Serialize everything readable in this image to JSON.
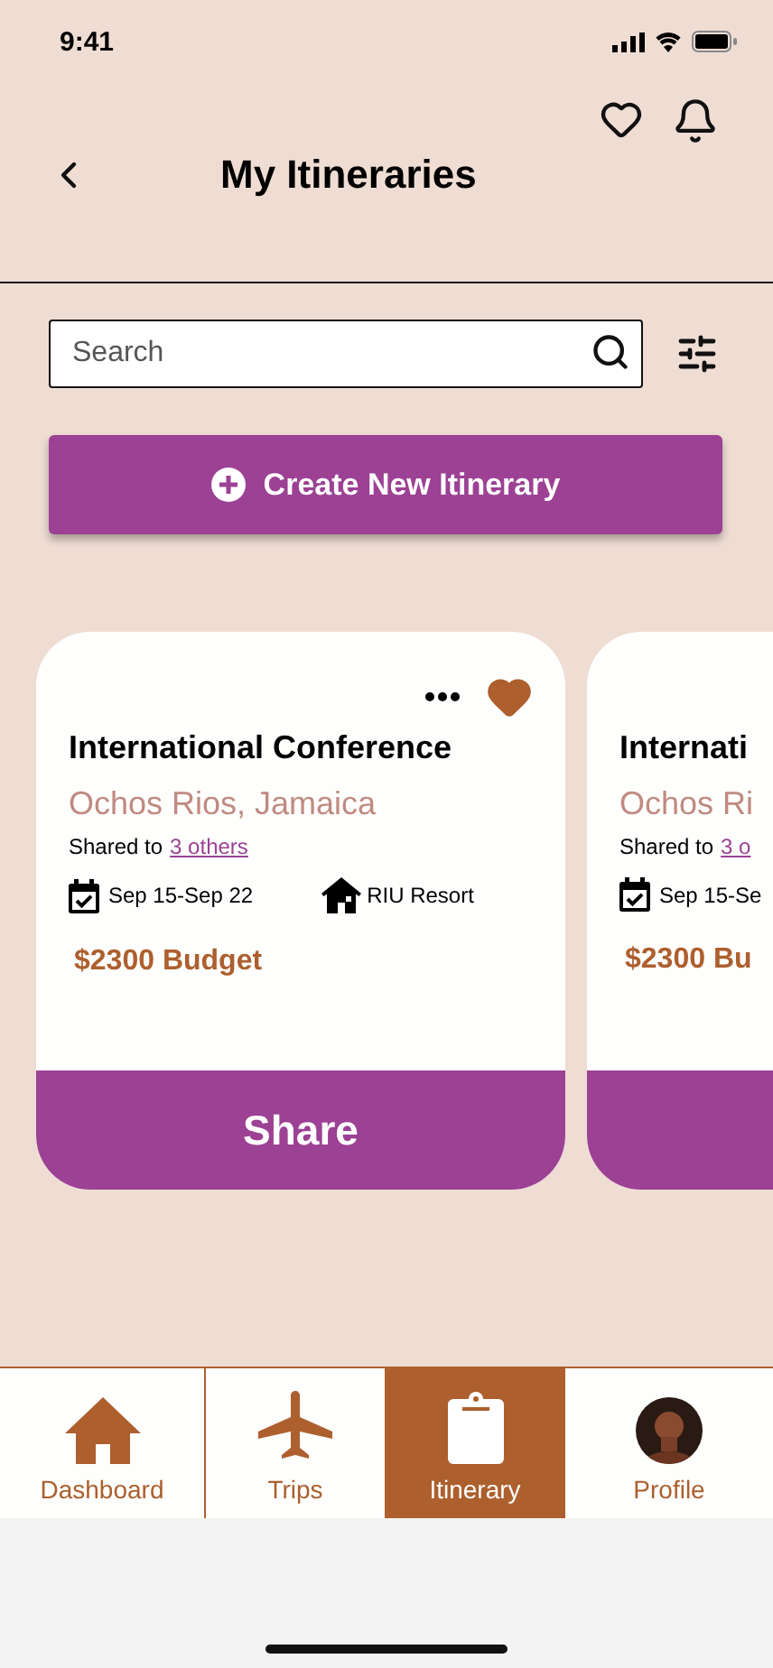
{
  "status_bar": {
    "time": "9:41"
  },
  "header": {
    "title": "My Itineraries"
  },
  "search": {
    "placeholder": "Search"
  },
  "create_button": {
    "label": "Create New Itinerary"
  },
  "cards": [
    {
      "title": "International Conference",
      "location": "Ochos Rios, Jamaica",
      "shared_prefix": "Shared to",
      "shared_link": "3 others",
      "dates": "Sep 15-Sep 22",
      "lodging": "RIU Resort",
      "budget": "$2300 Budget",
      "favorite": true,
      "button": "Share"
    },
    {
      "title": "Internati",
      "location": "Ochos Ri",
      "shared_prefix": "Shared to",
      "shared_link": "3 o",
      "dates": "Sep 15-Se",
      "budget": "$2300 Bu"
    }
  ],
  "nav": [
    {
      "kind": "home",
      "label": "Dashboard",
      "selected": false
    },
    {
      "kind": "plane",
      "label": "Trips",
      "selected": false
    },
    {
      "kind": "clipboard",
      "label": "Itinerary",
      "selected": true
    },
    {
      "kind": "avatar",
      "label": "Profile",
      "selected": false
    }
  ]
}
